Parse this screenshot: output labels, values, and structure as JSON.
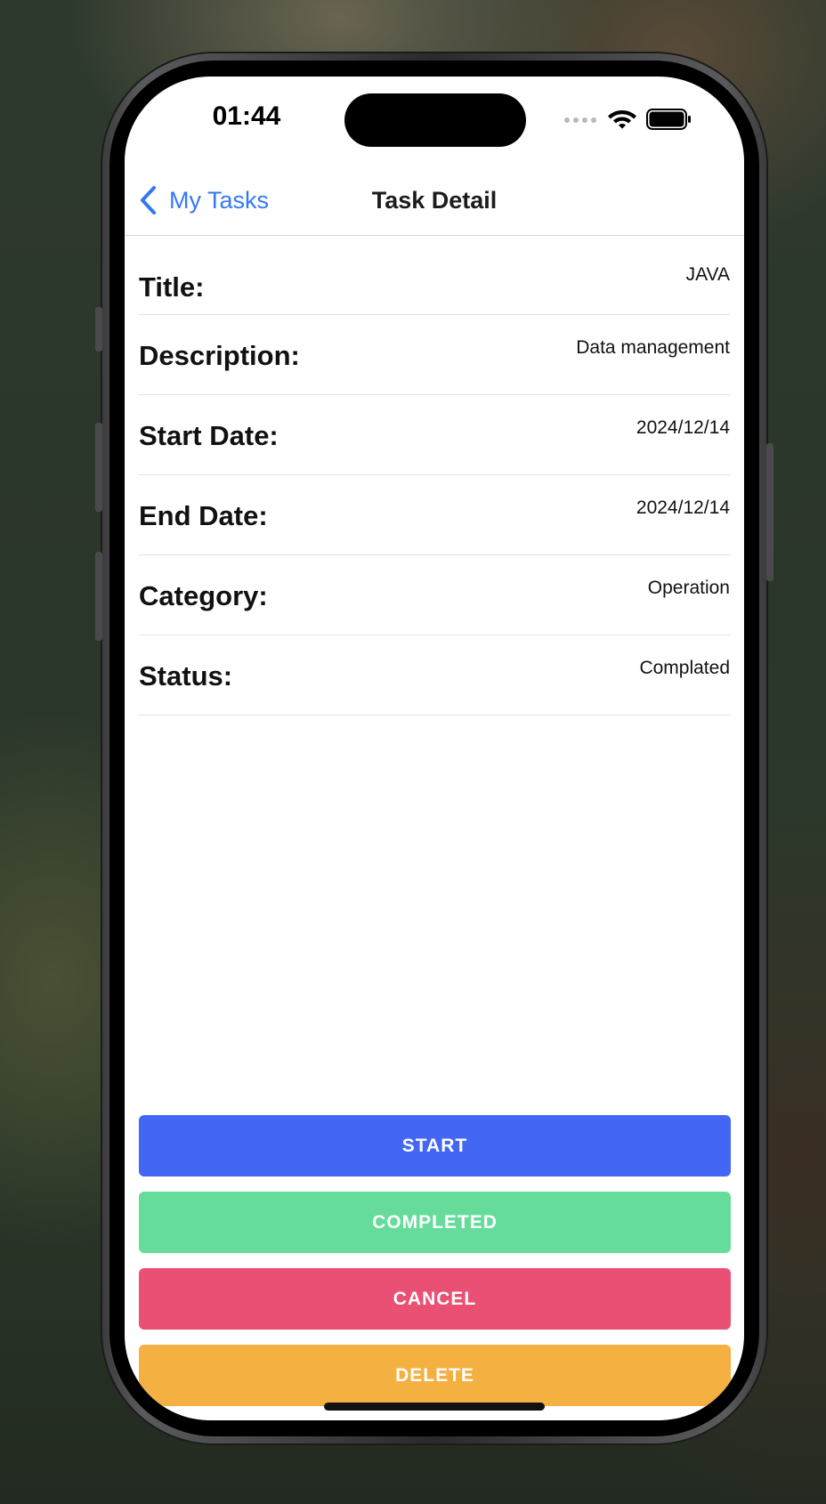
{
  "status_bar": {
    "time": "01:44",
    "icons": [
      "signal-dots-icon",
      "wifi-icon",
      "battery-icon"
    ]
  },
  "nav": {
    "back_label": "My Tasks",
    "title": "Task Detail",
    "accent_color": "#3478f6"
  },
  "details": [
    {
      "label": "Title:",
      "value": "JAVA"
    },
    {
      "label": "Description:",
      "value": "Data management"
    },
    {
      "label": "Start Date:",
      "value": "2024/12/14"
    },
    {
      "label": "End Date:",
      "value": "2024/12/14"
    },
    {
      "label": "Category:",
      "value": "Operation"
    },
    {
      "label": "Status:",
      "value": "Complated"
    }
  ],
  "actions": [
    {
      "label": "START",
      "color": "#4366f5"
    },
    {
      "label": "COMPLETED",
      "color": "#66dc9b"
    },
    {
      "label": "CANCEL",
      "color": "#ea5073"
    },
    {
      "label": "DELETE",
      "color": "#f4b041"
    }
  ]
}
